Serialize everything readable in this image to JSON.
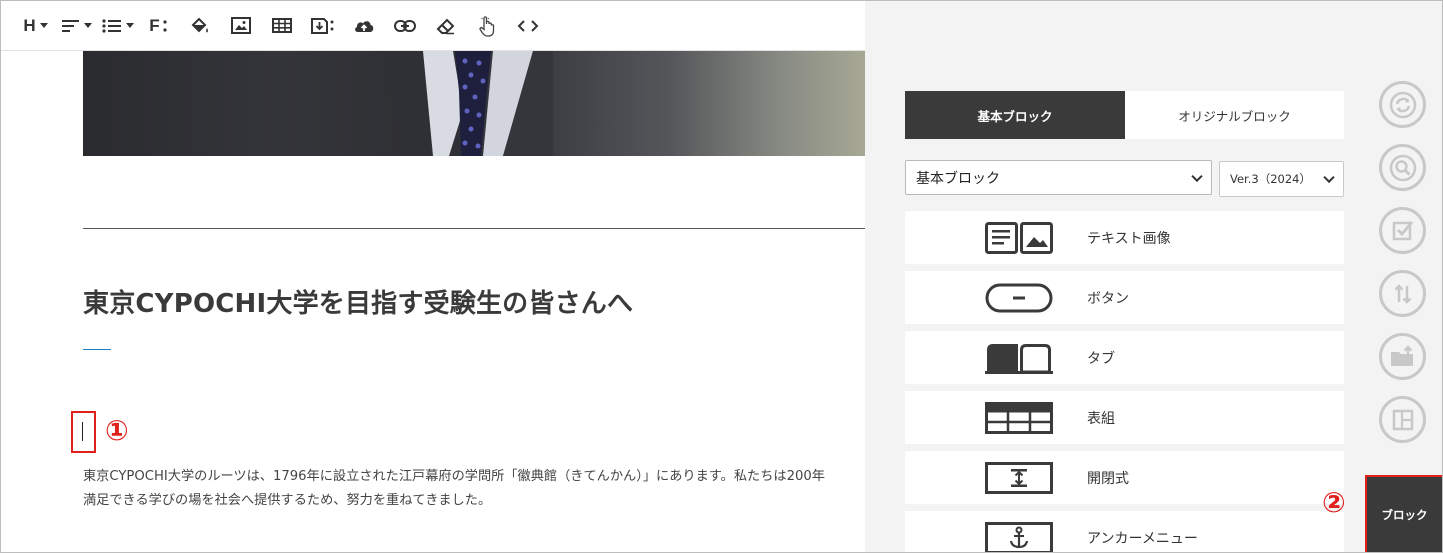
{
  "toolbar": {
    "heading_label": "H",
    "font_label": "F",
    "items": [
      "heading-dropdown",
      "align-dropdown",
      "list-dropdown",
      "font-size-button",
      "fill-color-button",
      "image-button",
      "table-button",
      "file-download-button",
      "upload-button",
      "link-button",
      "eraser-button",
      "pointer-button",
      "source-code-button"
    ]
  },
  "content": {
    "title": "東京CYPOCHI大学を目指す受験生の皆さんへ",
    "marker_1": "①",
    "body_line1": "東京CYPOCHI大学のルーツは、1796年に設立された江戸幕府の学問所「徽典館（きてんかん）」にあります。私たちは200年",
    "body_line2": "満足できる学びの場を社会へ提供するため、努力を重ねてきました。"
  },
  "panel": {
    "tabs": [
      {
        "label": "基本ブロック",
        "active": true
      },
      {
        "label": "オリジナルブロック",
        "active": false
      }
    ],
    "category_select": "基本ブロック",
    "version_select": "Ver.3（2024）",
    "blocks": [
      {
        "label": "テキスト画像",
        "icon": "text-image-icon"
      },
      {
        "label": "ボタン",
        "icon": "button-icon"
      },
      {
        "label": "タブ",
        "icon": "tab-icon"
      },
      {
        "label": "表組",
        "icon": "table-grid-icon"
      },
      {
        "label": "開閉式",
        "icon": "accordion-icon"
      },
      {
        "label": "アンカーメニュー",
        "icon": "anchor-icon"
      }
    ],
    "side_buttons": [
      "refresh-icon",
      "zoom-icon",
      "checkbox-icon",
      "sort-icon",
      "folder-upload-icon",
      "layout-icon"
    ],
    "block_button_label": "ブロック",
    "marker_2": "②"
  },
  "colors": {
    "dark": "#3a3a3a",
    "panel_bg": "#f3f3f3",
    "annotation_red": "#e0201b",
    "accent_blue": "#1f7fc4"
  }
}
